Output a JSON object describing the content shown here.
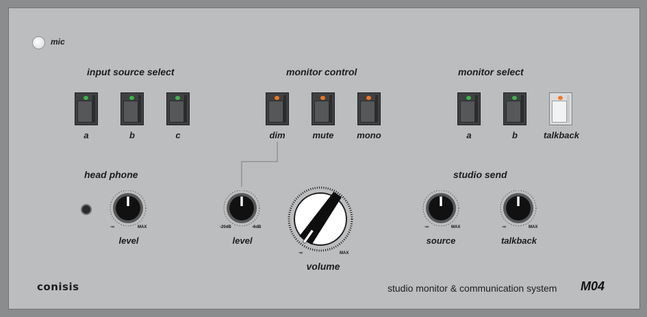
{
  "panel": {
    "mic_label": "mic",
    "brand": "conisis",
    "subtitle": "studio monitor &  communication system",
    "model": "M04"
  },
  "input_source_select": {
    "title": "input source select",
    "buttons": [
      {
        "label": "a",
        "led": "#3bb54a"
      },
      {
        "label": "b",
        "led": "#3bb54a"
      },
      {
        "label": "c",
        "led": "#3bb54a"
      }
    ]
  },
  "monitor_control": {
    "title": "monitor  control",
    "buttons": [
      {
        "label": "dim",
        "led": "#f0781e"
      },
      {
        "label": "mute",
        "led": "#f0781e"
      },
      {
        "label": "mono",
        "led": "#f0781e"
      }
    ]
  },
  "monitor_select": {
    "title": "monitor select",
    "buttons": [
      {
        "label": "a",
        "led": "#3bb54a"
      },
      {
        "label": "b",
        "led": "#3bb54a"
      },
      {
        "label": "talkback",
        "led": "#f0781e"
      }
    ]
  },
  "head_phone": {
    "title": "head phone",
    "knob": {
      "label": "level",
      "min": "-∞",
      "max": "MAX"
    }
  },
  "dim_level": {
    "knob": {
      "label": "level",
      "min": "-20dB",
      "max": "-6dB"
    }
  },
  "volume": {
    "knob": {
      "label": "volume",
      "min": "-∞",
      "max": "MAX"
    }
  },
  "studio_send": {
    "title": "studio send",
    "knobs": [
      {
        "label": "source",
        "min": "-∞",
        "max": "MAX"
      },
      {
        "label": "talkback",
        "min": "-∞",
        "max": "MAX"
      }
    ]
  },
  "colors": {
    "panel": "#bcbdbf",
    "frame": "#8a8c8e",
    "button": "#3f4042",
    "led_green": "#3bb54a",
    "led_orange": "#f0781e"
  }
}
